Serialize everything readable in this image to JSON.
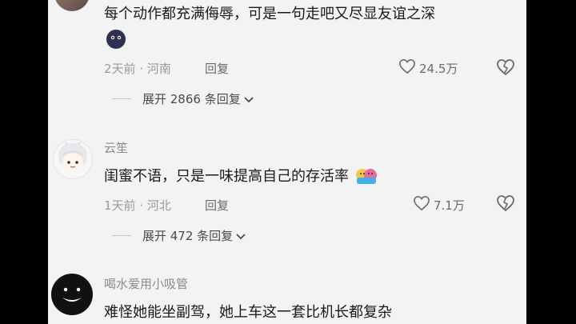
{
  "comments": [
    {
      "text": "每个动作都充满侮辱，可是一句走吧又尽显友谊之深",
      "meta": "2天前 · 河南",
      "reply_label": "回复",
      "likes": "24.5万",
      "expand_label": "展开 2866 条回复"
    },
    {
      "username": "云笙",
      "text": "闺蜜不语，只是一味提高自己的存活率",
      "meta": "1天前 · 河北",
      "reply_label": "回复",
      "likes": "7.1万",
      "expand_label": "展开 472 条回复"
    },
    {
      "username": "喝水爱用小吸管",
      "text": "难怪她能坐副驾，她上车这一套比机长都复杂"
    }
  ],
  "colors": {
    "background": "#f3f3f3",
    "text": "#1a1a1a",
    "muted": "#9a9a9a"
  }
}
